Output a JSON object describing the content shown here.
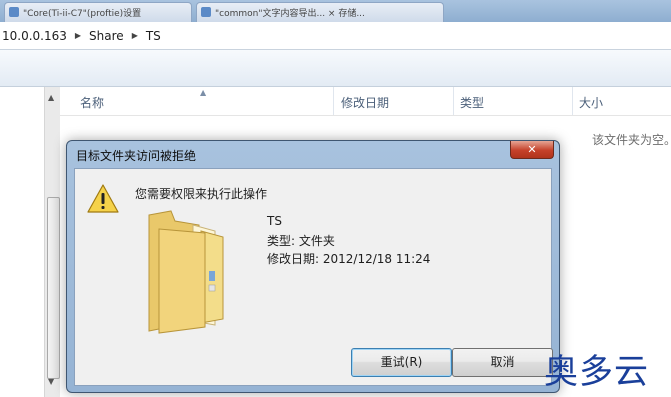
{
  "browser_tabs": [
    {
      "label": "\"Core(Ti-ii-C7\"(proftie)设置"
    },
    {
      "label": "\"common\"文字内容导出... × 存储..."
    }
  ],
  "breadcrumb": [
    "10.0.0.163",
    "Share",
    "TS"
  ],
  "columns": [
    "名称",
    "修改日期",
    "类型",
    "大小"
  ],
  "empty_message": "该文件夹为空。",
  "dialog": {
    "title": "目标文件夹访问被拒绝",
    "close": "✕",
    "message": "您需要权限来执行此操作",
    "item_name": "TS",
    "item_type": "类型: 文件夹",
    "item_modified": "修改日期: 2012/12/18 11:24",
    "retry_button": "重试(R)",
    "cancel_button": "取消"
  },
  "watermark": "奥多云",
  "icons": {
    "warning": "warning-icon",
    "folder": "folder-icon"
  },
  "colors": {
    "dialog_frame": "#a8c2de",
    "close_button": "#c5412a",
    "watermark": "#1a3f9a"
  }
}
